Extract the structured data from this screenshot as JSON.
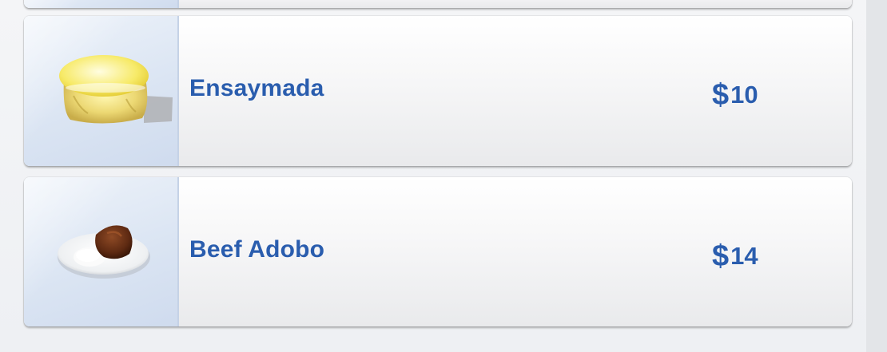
{
  "items": [
    {
      "name": "Ensaymada",
      "currency_symbol": "$",
      "price": "10",
      "icon": "ensaymada-food-icon"
    },
    {
      "name": "Beef Adobo",
      "currency_symbol": "$",
      "price": "14",
      "icon": "beef-adobo-food-icon"
    }
  ],
  "colors": {
    "text_accent": "#2a5dae",
    "thumb_bg": "#dbe5f3"
  }
}
